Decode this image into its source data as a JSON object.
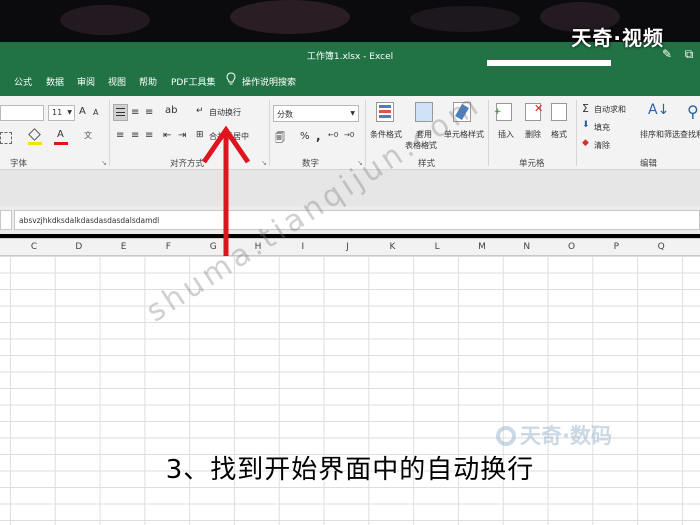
{
  "window": {
    "title": "工作簿1.xlsx  -  Excel",
    "watermark_top": "天奇·视频"
  },
  "menu": {
    "tabs": [
      "公式",
      "数据",
      "审阅",
      "视图",
      "帮助",
      "PDF工具集",
      "操作说明搜索"
    ]
  },
  "ribbon": {
    "font_size": "11",
    "font_grow": "A",
    "font_shrink": "A",
    "wrap_text": "自动换行",
    "merge_center": "合并后居中",
    "number_format": "分数",
    "percent": "%",
    "comma": ",",
    "conditional_format": "条件格式",
    "table_format_1": "套用",
    "table_format_2": "表格格式",
    "cell_styles": "单元格样式",
    "insert": "插入",
    "delete": "删除",
    "format": "格式",
    "autosum": "自动求和",
    "fill": "填充",
    "clear": "清除",
    "sort_filter": "排序和筛选",
    "find_select": "查找和选择",
    "groups": {
      "font": "字体",
      "alignment": "对齐方式",
      "number": "数字",
      "styles": "样式",
      "cells": "单元格",
      "editing": "编辑"
    }
  },
  "formula_bar": {
    "content": "absvzjhkdksdalkdasdasdasdalsdamdl"
  },
  "columns": [
    "C",
    "D",
    "E",
    "F",
    "G",
    "H",
    "I",
    "J",
    "K",
    "L",
    "M",
    "N",
    "O",
    "P",
    "Q"
  ],
  "watermarks": {
    "diagonal": "shuma.tianqijun.com",
    "brand": "天奇·数码"
  },
  "caption": "3、找到开始界面中的自动换行",
  "colors": {
    "excel_green": "#217346",
    "arrow_red": "#e0141e"
  }
}
